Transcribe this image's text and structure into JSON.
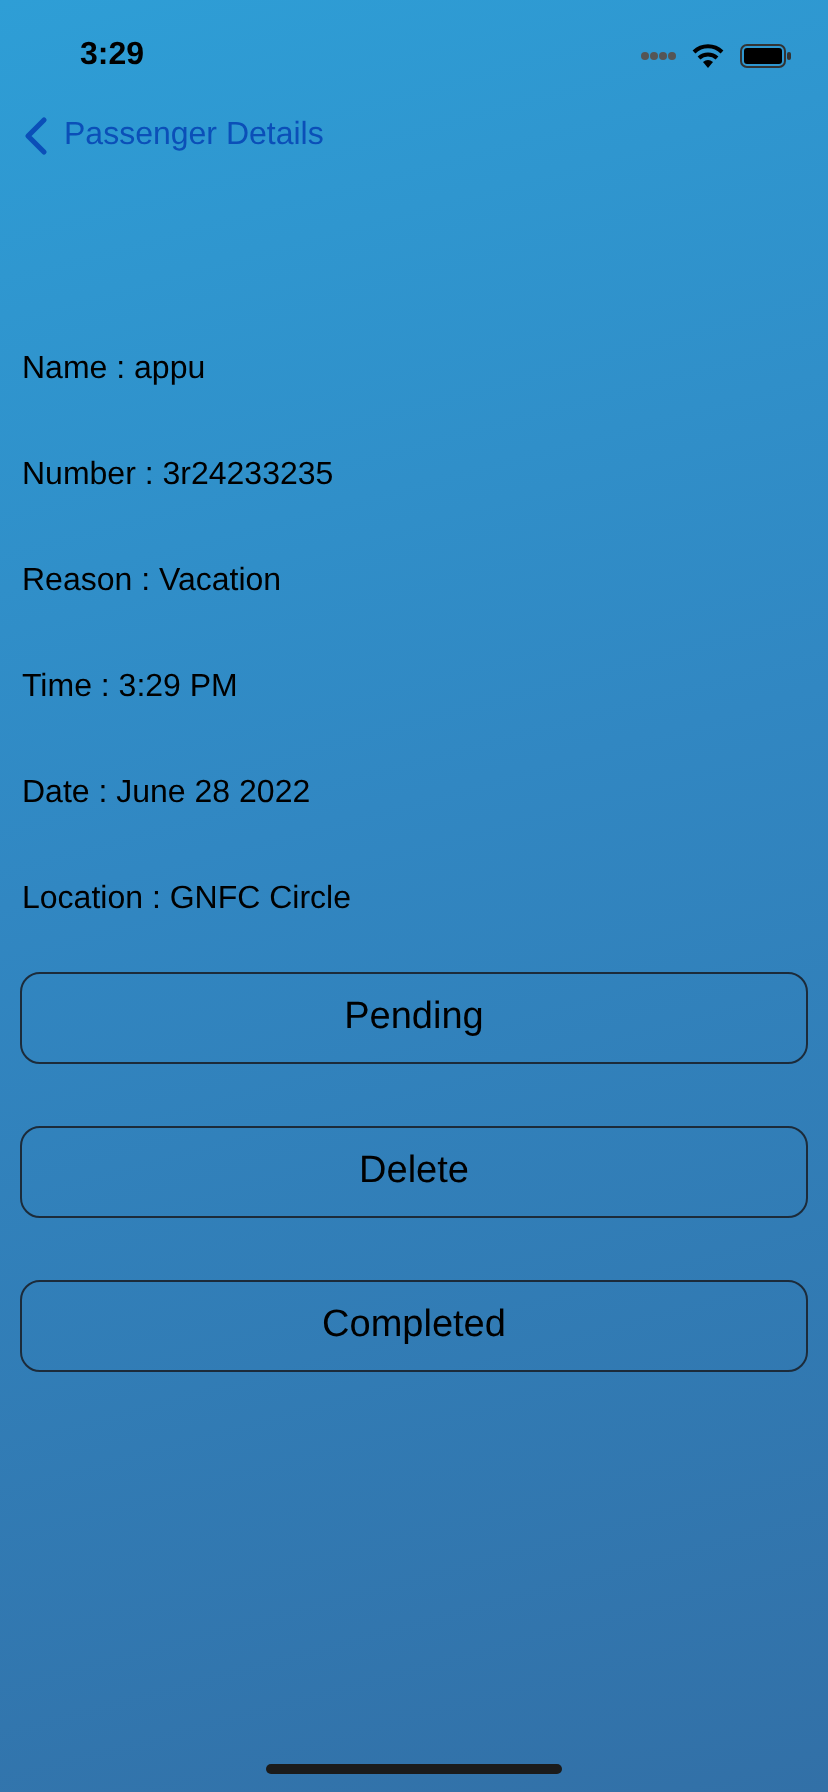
{
  "status_bar": {
    "time": "3:29"
  },
  "nav": {
    "back_label": "Passenger Details"
  },
  "details": [
    {
      "text": "Name : appu"
    },
    {
      "text": "Number : 3r24233235"
    },
    {
      "text": "Reason : Vacation"
    },
    {
      "text": "Time : 3:29 PM"
    },
    {
      "text": "Date : June 28 2022"
    },
    {
      "text": "Location : GNFC Circle"
    }
  ],
  "buttons": [
    {
      "label": "Pending"
    },
    {
      "label": "Delete"
    },
    {
      "label": "Completed"
    }
  ]
}
